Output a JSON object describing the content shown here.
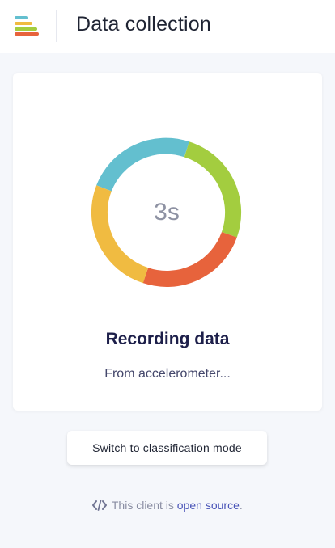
{
  "header": {
    "title": "Data collection",
    "logo_icon": "stacked-bars-logo-icon"
  },
  "recording": {
    "countdown": "3s",
    "title": "Recording data",
    "subtitle": "From accelerometer...",
    "ring_colors": [
      "#63bfcf",
      "#a3cd3f",
      "#e7633c",
      "#f0bb41"
    ]
  },
  "actions": {
    "switch_mode_label": "Switch to classification mode"
  },
  "footer": {
    "icon": "code-icon",
    "prefix": "This client is",
    "link_text": "open source",
    "suffix": "."
  }
}
